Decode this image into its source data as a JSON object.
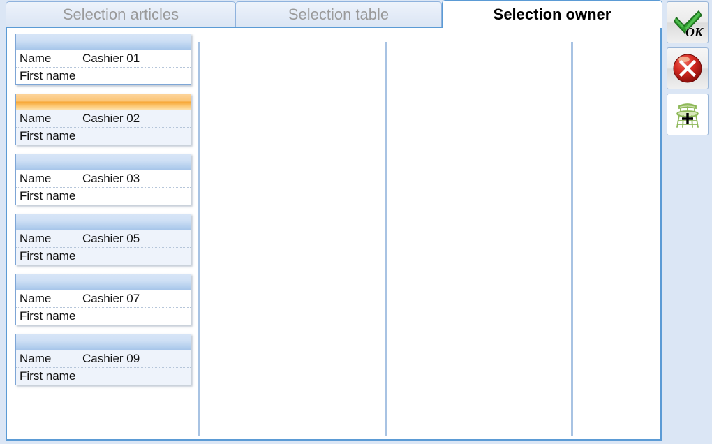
{
  "window": {
    "title": "Selection owner"
  },
  "tabs": [
    {
      "id": "articles",
      "label": "Selection articles",
      "active": false
    },
    {
      "id": "table",
      "label": "Selection table",
      "active": false
    },
    {
      "id": "owner",
      "label": "Selection owner",
      "active": true
    }
  ],
  "owner_list": {
    "field_labels": {
      "name": "Name",
      "first_name": "First name"
    },
    "cards": [
      {
        "name": "Cashier 01",
        "first_name": "",
        "selected": false,
        "tint": false
      },
      {
        "name": "Cashier 02",
        "first_name": "",
        "selected": true,
        "tint": false
      },
      {
        "name": "Cashier 03",
        "first_name": "",
        "selected": false,
        "tint": false
      },
      {
        "name": "Cashier 05",
        "first_name": "",
        "selected": false,
        "tint": true
      },
      {
        "name": "Cashier 07",
        "first_name": "",
        "selected": false,
        "tint": false
      },
      {
        "name": "Cashier 09",
        "first_name": "",
        "selected": false,
        "tint": true
      }
    ]
  },
  "actions": [
    {
      "id": "ok",
      "icon": "green-check-ok-icon",
      "label": "OK"
    },
    {
      "id": "cancel",
      "icon": "red-x-cancel-icon",
      "label": ""
    },
    {
      "id": "add-seat",
      "icon": "bar-stool-plus-icon",
      "label": ""
    }
  ],
  "colors": {
    "window_background": "#dbe6f5",
    "panel_border": "#5b9bd5",
    "tab_inactive_text": "#9a9a9a",
    "tab_active_text": "#000000",
    "card_header_blue": "#aecbec",
    "card_header_orange": "#f7a838",
    "divider": "#a8c3e3",
    "ok_green": "#2f9e2f",
    "cancel_red": "#cc2222",
    "stool_green": "#8db858"
  }
}
